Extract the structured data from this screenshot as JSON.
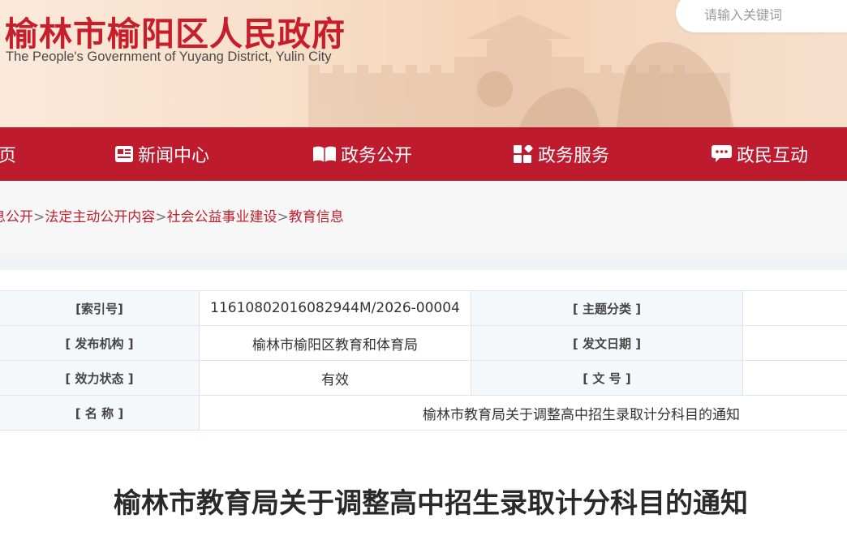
{
  "header": {
    "title": "榆林市榆阳区人民政府",
    "subtitle": "The People's Government of Yuyang District, Yulin City",
    "search_placeholder": "请输入关键词"
  },
  "nav": {
    "items": [
      {
        "label": "页",
        "icon": "home-icon"
      },
      {
        "label": "新闻中心",
        "icon": "newspaper-icon"
      },
      {
        "label": "政务公开",
        "icon": "open-book-icon"
      },
      {
        "label": "政务服务",
        "icon": "grid-apps-icon"
      },
      {
        "label": "政民互动",
        "icon": "chat-bubble-icon"
      }
    ]
  },
  "breadcrumb": {
    "items": [
      "息公开",
      "法定主动公开内容",
      "社会公益事业建设",
      "教育信息"
    ],
    "separator": ">"
  },
  "meta": {
    "index_label": "[索引号]",
    "index_value": "11610802016082944M/2026-00004",
    "topic_label": "[ 主题分类 ]",
    "topic_value": "",
    "publisher_label": "[ 发布机构 ]",
    "publisher_value": "榆林市榆阳区教育和体育局",
    "date_label": "[ 发文日期 ]",
    "date_value": "",
    "status_label": "[ 效力状态 ]",
    "status_value": "有效",
    "docno_label": "[ 文 号 ]",
    "docno_value": "",
    "name_label": "[ 名 称 ]",
    "name_value": "榆林市教育局关于调整高中招生录取计分科目的通知"
  },
  "article": {
    "title": "榆林市教育局关于调整高中招生录取计分科目的通知"
  },
  "colors": {
    "brand_red": "#be1b2e",
    "title_red": "#c81d2a",
    "label_bg": "#f5f8fb"
  }
}
